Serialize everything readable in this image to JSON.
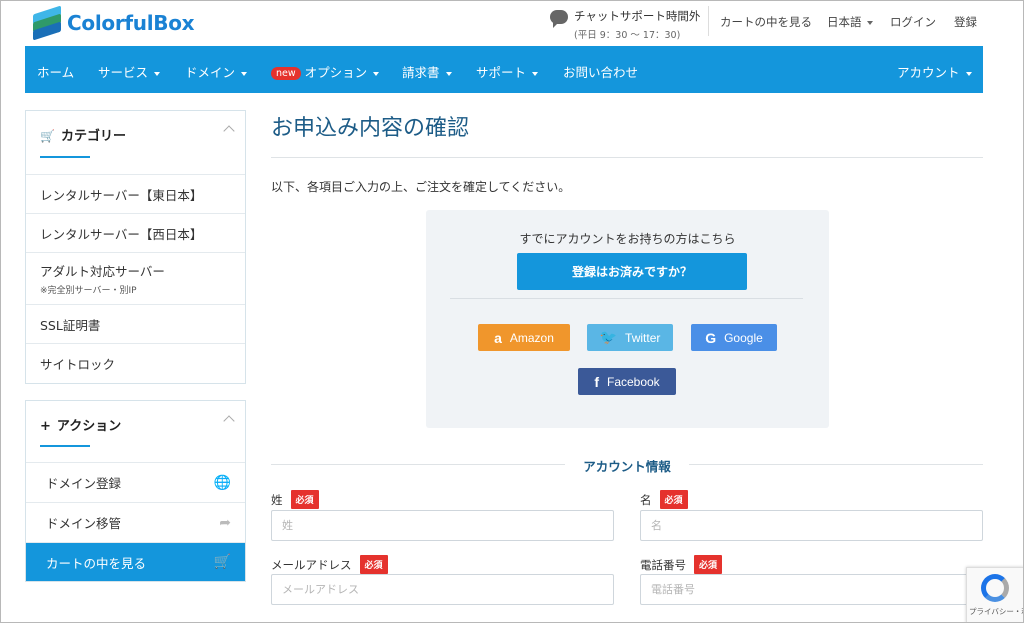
{
  "header": {
    "logo_text": "ColorfulBox",
    "chat_title": "チャットサポート時間外",
    "chat_hours": "(平日 9：30 〜 17：30)",
    "cart_link": "カートの中を見る",
    "language": "日本語",
    "login": "ログイン",
    "register": "登録"
  },
  "nav": {
    "home": "ホーム",
    "services": "サービス",
    "domain": "ドメイン",
    "new_badge": "new",
    "options": "オプション",
    "invoices": "請求書",
    "support": "サポート",
    "contact": "お問い合わせ",
    "account": "アカウント"
  },
  "sidebar": {
    "category_title": "カテゴリー",
    "categories": [
      {
        "label": "レンタルサーバー【東日本】"
      },
      {
        "label": "レンタルサーバー【西日本】"
      },
      {
        "label": "アダルト対応サーバー",
        "sub": "※完全別サーバー・別IP"
      },
      {
        "label": "SSL証明書"
      },
      {
        "label": "サイトロック"
      }
    ],
    "action_title": "アクション",
    "actions": [
      {
        "label": "ドメイン登録",
        "icon": "globe-icon"
      },
      {
        "label": "ドメイン移管",
        "icon": "share-arrow-icon"
      },
      {
        "label": "カートの中を見る",
        "icon": "cart-icon"
      }
    ]
  },
  "main": {
    "title": "お申込み内容の確認",
    "intro": "以下、各項目ご入力の上、ご注文を確定してください。",
    "login_lead": "すでにアカウントをお持ちの方はこちら",
    "login_button": "登録はお済みですか？",
    "social": {
      "amazon": "Amazon",
      "twitter": "Twitter",
      "google": "Google",
      "facebook": "Facebook"
    },
    "section_title": "アカウント情報",
    "required_label": "必須",
    "fields": {
      "last_name_label": "姓",
      "last_name_placeholder": "姓",
      "first_name_label": "名",
      "first_name_placeholder": "名",
      "email_label": "メールアドレス",
      "email_placeholder": "メールアドレス",
      "phone_label": "電話番号",
      "phone_placeholder": "電話番号"
    }
  },
  "recaptcha": {
    "text": "プライバシー・利用規約"
  },
  "colors": {
    "primary": "#1496dc",
    "title": "#1d5c87",
    "required": "#e5322d",
    "amazon": "#f0962c",
    "twitter": "#5ab6e5",
    "google": "#4a8fe7",
    "facebook": "#3b5998"
  }
}
